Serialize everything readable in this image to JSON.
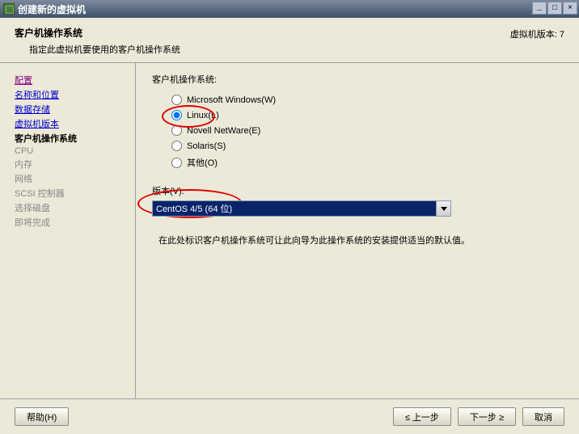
{
  "window": {
    "title": "创建新的虚拟机"
  },
  "header": {
    "title": "客户机操作系统",
    "subtitle": "指定此虚拟机要使用的客户机操作系统",
    "version_label": "虚拟机版本: 7"
  },
  "sidebar": {
    "items": [
      {
        "label": "配置",
        "state": "visited"
      },
      {
        "label": "名称和位置",
        "state": "link"
      },
      {
        "label": "数据存储",
        "state": "link"
      },
      {
        "label": "虚拟机版本",
        "state": "link"
      },
      {
        "label": "客户机操作系统",
        "state": "active"
      },
      {
        "label": "CPU",
        "state": "disabled"
      },
      {
        "label": "内存",
        "state": "disabled"
      },
      {
        "label": "网络",
        "state": "disabled"
      },
      {
        "label": "SCSI 控制器",
        "state": "disabled"
      },
      {
        "label": "选择磁盘",
        "state": "disabled"
      },
      {
        "label": "即将完成",
        "state": "disabled"
      }
    ]
  },
  "main": {
    "os_section_label": "客户机操作系统:",
    "os_options": [
      {
        "label": "Microsoft Windows(W)",
        "checked": false
      },
      {
        "label": "Linux(L)",
        "checked": true
      },
      {
        "label": "Novell NetWare(E)",
        "checked": false
      },
      {
        "label": "Solaris(S)",
        "checked": false
      },
      {
        "label": "其他(O)",
        "checked": false
      }
    ],
    "version_label": "版本(V):",
    "version_selected": "CentOS 4/5 (64 位)",
    "hint": "在此处标识客户机操作系统可让此向导为此操作系统的安装提供适当的默认值。"
  },
  "footer": {
    "help": "帮助(H)",
    "back": "≤ 上一步",
    "next": "下一步 ≥",
    "cancel": "取消"
  }
}
